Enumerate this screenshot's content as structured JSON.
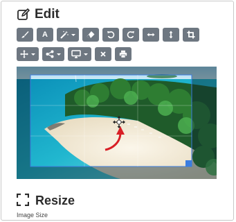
{
  "header": {
    "title": "Edit",
    "icon": "edit-icon"
  },
  "toolbar": {
    "row1": [
      {
        "name": "brush-tool-button",
        "icon": "brush-icon"
      },
      {
        "name": "text-tool-button",
        "label": "A"
      },
      {
        "name": "magic-wand-dropdown-button",
        "icon": "magic-wand-icon",
        "dropdown": true
      },
      {
        "name": "eraser-tool-button",
        "icon": "eraser-icon"
      },
      {
        "name": "undo-button",
        "icon": "undo-icon"
      },
      {
        "name": "redo-button",
        "icon": "redo-icon"
      },
      {
        "name": "flip-horizontal-button",
        "icon": "arrows-horizontal-icon"
      },
      {
        "name": "flip-vertical-button",
        "icon": "arrows-vertical-icon"
      },
      {
        "name": "crop-button",
        "icon": "crop-icon"
      }
    ],
    "row2": [
      {
        "name": "move-dropdown-button",
        "icon": "move-icon",
        "dropdown": true
      },
      {
        "name": "share-dropdown-button",
        "icon": "share-icon",
        "dropdown": true
      },
      {
        "name": "display-dropdown-button",
        "icon": "monitor-icon",
        "dropdown": true
      },
      {
        "name": "close-button",
        "icon": "close-icon"
      },
      {
        "name": "print-button",
        "icon": "print-icon"
      }
    ]
  },
  "canvas": {
    "image_subject": "tropical beach with palm trees",
    "crop_active": true
  },
  "resize": {
    "title": "Resize",
    "icon": "fullscreen-icon",
    "image_size_label": "Image Size"
  },
  "colors": {
    "button_bg": "#6e7781",
    "selection": "#3b7de0",
    "text": "#2b2b2b"
  }
}
